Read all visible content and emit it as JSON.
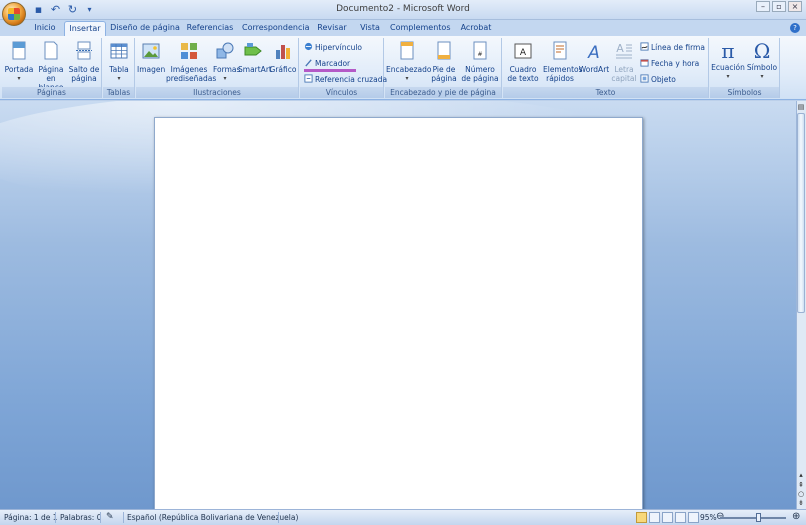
{
  "window": {
    "title": "Documento2 - Microsoft Word"
  },
  "tabs": [
    {
      "label": "Inicio"
    },
    {
      "label": "Insertar"
    },
    {
      "label": "Diseño de página"
    },
    {
      "label": "Referencias"
    },
    {
      "label": "Correspondencia"
    },
    {
      "label": "Revisar"
    },
    {
      "label": "Vista"
    },
    {
      "label": "Complementos"
    },
    {
      "label": "Acrobat"
    }
  ],
  "ribbon": {
    "paginas": {
      "label": "Páginas",
      "portada": "Portada",
      "pagina_en_blanco": "Página en blanco",
      "salto_de_pagina": "Salto de página"
    },
    "tablas": {
      "label": "Tablas",
      "tabla": "Tabla"
    },
    "ilustraciones": {
      "label": "Ilustraciones",
      "imagen": "Imagen",
      "imagenes_prediseñadas": "Imágenes prediseñadas",
      "formas": "Formas",
      "smartart": "SmartArt",
      "grafico": "Gráfico"
    },
    "vinculos": {
      "label": "Vínculos",
      "hipervinculo": "Hipervínculo",
      "marcador": "Marcador",
      "referencia_cruzada": "Referencia cruzada"
    },
    "encabezado": {
      "label": "Encabezado y pie de página",
      "encabezado": "Encabezado",
      "pie_de_pagina": "Pie de página",
      "numero_de_pagina": "Número de página"
    },
    "texto": {
      "label": "Texto",
      "cuadro_de_texto": "Cuadro de texto",
      "elementos_rapidos": "Elementos rápidos",
      "wordart": "WordArt",
      "letra_capital": "Letra capital",
      "linea_de_firma": "Línea de firma",
      "fecha_y_hora": "Fecha y hora",
      "objeto": "Objeto"
    },
    "simbolos": {
      "label": "Símbolos",
      "ecuacion": "Ecuación",
      "simbolo": "Símbolo"
    }
  },
  "status": {
    "pagina": "Página: 1 de 1",
    "palabras": "Palabras: 0",
    "idioma": "Español (República Bolivariana de Venezuela)",
    "zoom": "95%"
  },
  "colors": {
    "ribbon_text": "#15428b",
    "accent": "#2e6fc9"
  }
}
